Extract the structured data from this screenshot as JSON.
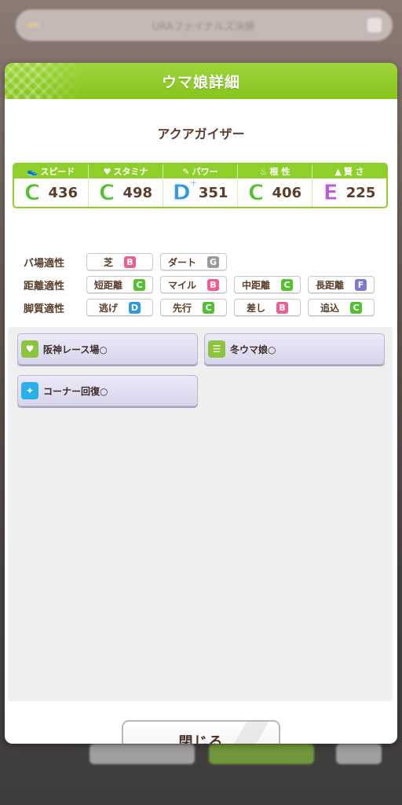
{
  "background": {
    "topbar_badge": "",
    "topbar_title": "URAファイナルズ決勝"
  },
  "dialog": {
    "title": "ウマ娘詳細",
    "character_name": "アクアガイザー"
  },
  "stats": [
    {
      "label": "スピード",
      "icon": "shoe-icon",
      "grade": "C",
      "plus": false,
      "value": "436",
      "color": "#55c132"
    },
    {
      "label": "スタミナ",
      "icon": "heart-icon",
      "grade": "C",
      "plus": false,
      "value": "498",
      "color": "#55c132"
    },
    {
      "label": "パワー",
      "icon": "muscle-icon",
      "grade": "D",
      "plus": true,
      "value": "351",
      "color": "#2e9be0"
    },
    {
      "label": "根 性",
      "icon": "flame-icon",
      "grade": "C",
      "plus": false,
      "value": "406",
      "color": "#55c132"
    },
    {
      "label": "賢 さ",
      "icon": "mortarboard-icon",
      "grade": "E",
      "plus": false,
      "value": "225",
      "color": "#b85bd2"
    }
  ],
  "aptitude": {
    "track": {
      "label": "バ場適性",
      "items": [
        {
          "name": "芝",
          "grade": "B"
        },
        {
          "name": "ダート",
          "grade": "G"
        }
      ]
    },
    "distance": {
      "label": "距離適性",
      "items": [
        {
          "name": "短距離",
          "grade": "C"
        },
        {
          "name": "マイル",
          "grade": "B"
        },
        {
          "name": "中距離",
          "grade": "C"
        },
        {
          "name": "長距離",
          "grade": "F"
        }
      ]
    },
    "style": {
      "label": "脚質適性",
      "items": [
        {
          "name": "逃げ",
          "grade": "D"
        },
        {
          "name": "先行",
          "grade": "C"
        },
        {
          "name": "差し",
          "grade": "B"
        },
        {
          "name": "追込",
          "grade": "C"
        }
      ]
    }
  },
  "grade_colors": {
    "B": "#ee5d93",
    "C": "#55c132",
    "D": "#2e9be0",
    "E": "#b85bd2",
    "F": "#7c79d8",
    "G": "#9a9a9a"
  },
  "skills": [
    {
      "name": "阪神レース場○",
      "icon": "heart-skill-icon",
      "color": "#8bc53c"
    },
    {
      "name": "冬ウマ娘○",
      "icon": "card-skill-icon",
      "color": "#8bc53c"
    },
    {
      "name": "コーナー回復○",
      "icon": "sparkle-skill-icon",
      "color": "#2ab0e8"
    }
  ],
  "close_label": "閉じる"
}
